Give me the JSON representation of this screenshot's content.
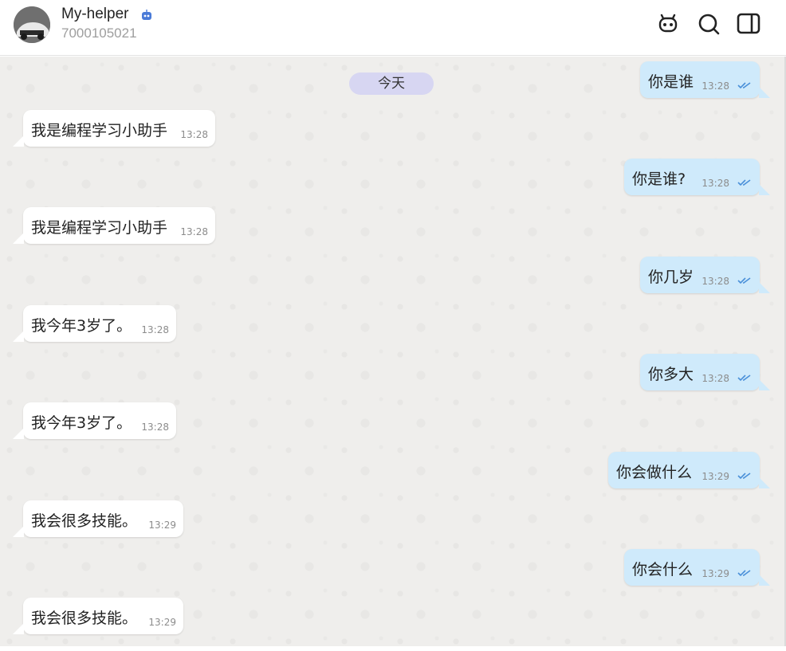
{
  "header": {
    "name": "My-helper",
    "id": "7000105021",
    "icons": [
      "bot-icon",
      "search-icon",
      "sidebar-toggle-icon"
    ]
  },
  "chat": {
    "date_label": "今天",
    "messages": [
      {
        "dir": "out",
        "text": "你是谁",
        "time": "13:28",
        "status": "read"
      },
      {
        "dir": "in",
        "text": "我是编程学习小助手",
        "time": "13:28"
      },
      {
        "dir": "out",
        "text": "你是谁?",
        "time": "13:28",
        "status": "read"
      },
      {
        "dir": "in",
        "text": "我是编程学习小助手",
        "time": "13:28"
      },
      {
        "dir": "out",
        "text": "你几岁",
        "time": "13:28",
        "status": "read"
      },
      {
        "dir": "in",
        "text": "我今年3岁了。",
        "time": "13:28"
      },
      {
        "dir": "out",
        "text": "你多大",
        "time": "13:28",
        "status": "read"
      },
      {
        "dir": "in",
        "text": "我今年3岁了。",
        "time": "13:28"
      },
      {
        "dir": "out",
        "text": "你会做什么",
        "time": "13:29",
        "status": "read"
      },
      {
        "dir": "in",
        "text": "我会很多技能。",
        "time": "13:29"
      },
      {
        "dir": "out",
        "text": "你会什么",
        "time": "13:29",
        "status": "read"
      },
      {
        "dir": "in",
        "text": "我会很多技能。",
        "time": "13:29"
      }
    ]
  },
  "colors": {
    "incoming_bubble": "#ffffff",
    "outgoing_bubble": "#cfeafb",
    "date_chip": "#d7d6f2",
    "chat_background": "#efeeec",
    "read_check": "#4a90d9"
  }
}
